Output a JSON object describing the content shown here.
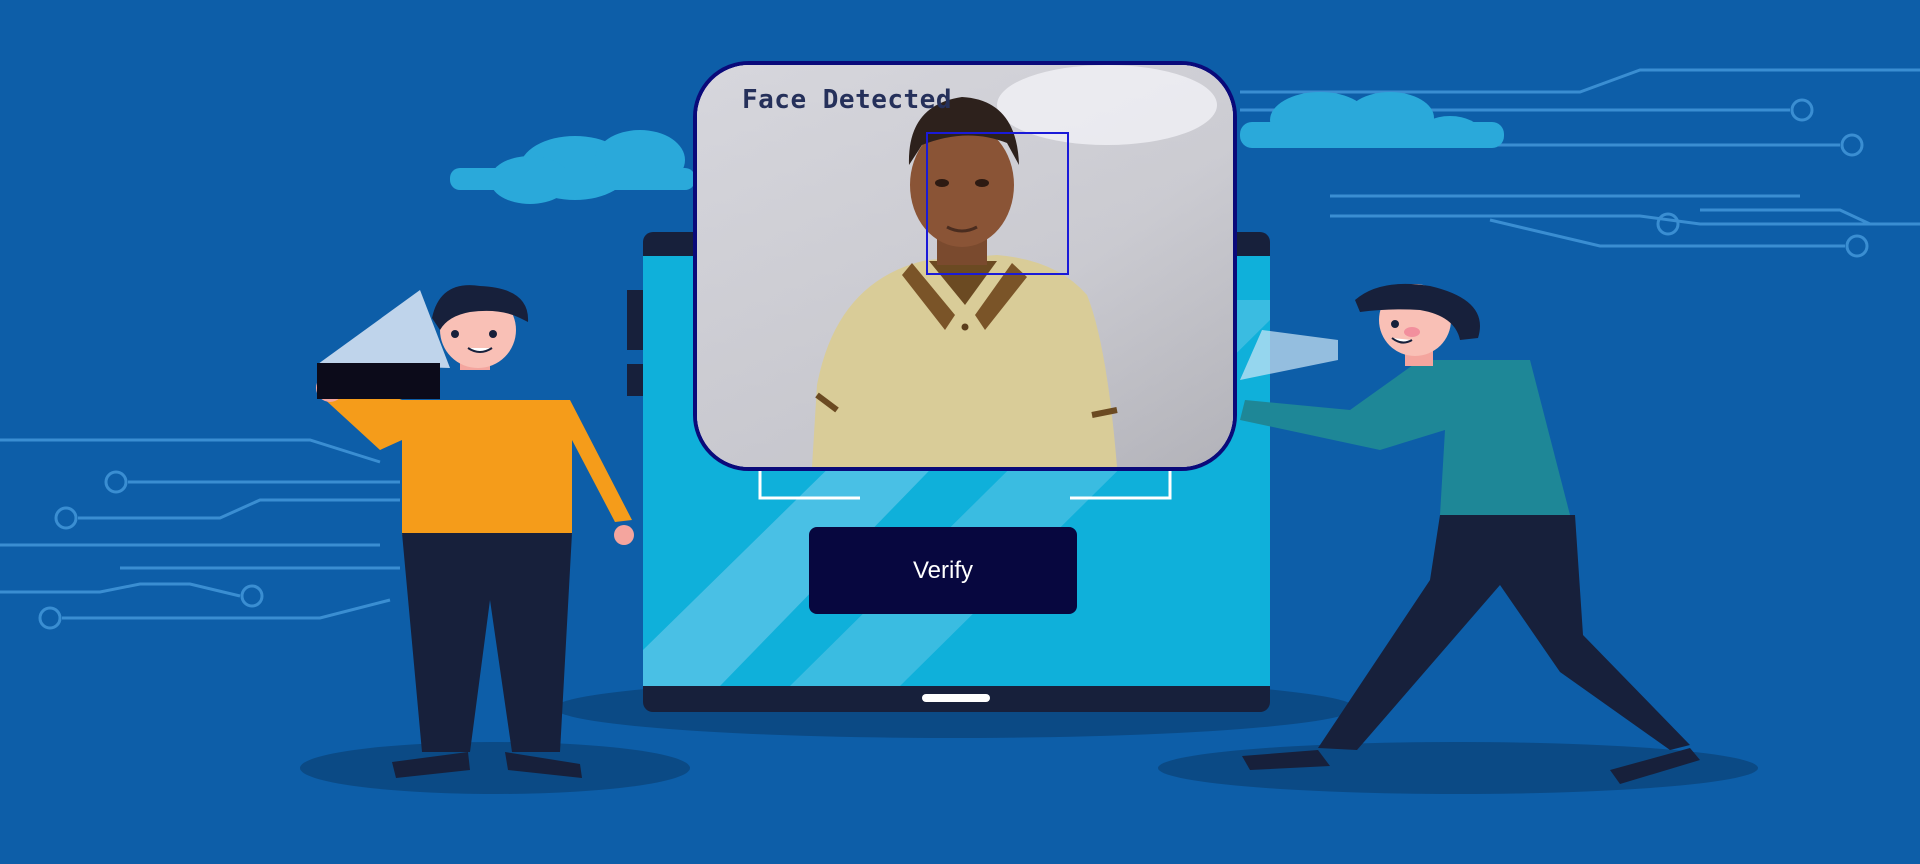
{
  "camera": {
    "overlay_text": "Face Detected"
  },
  "actions": {
    "verify_label": "Verify"
  },
  "colors": {
    "background": "#0d5ea8",
    "button": "#07073f",
    "frame_border": "#0a0a7a",
    "face_box": "#1a1ad8",
    "tablet_screen": "#0fb0da"
  },
  "icons": [
    "cloud-icon",
    "circuit-lines"
  ]
}
